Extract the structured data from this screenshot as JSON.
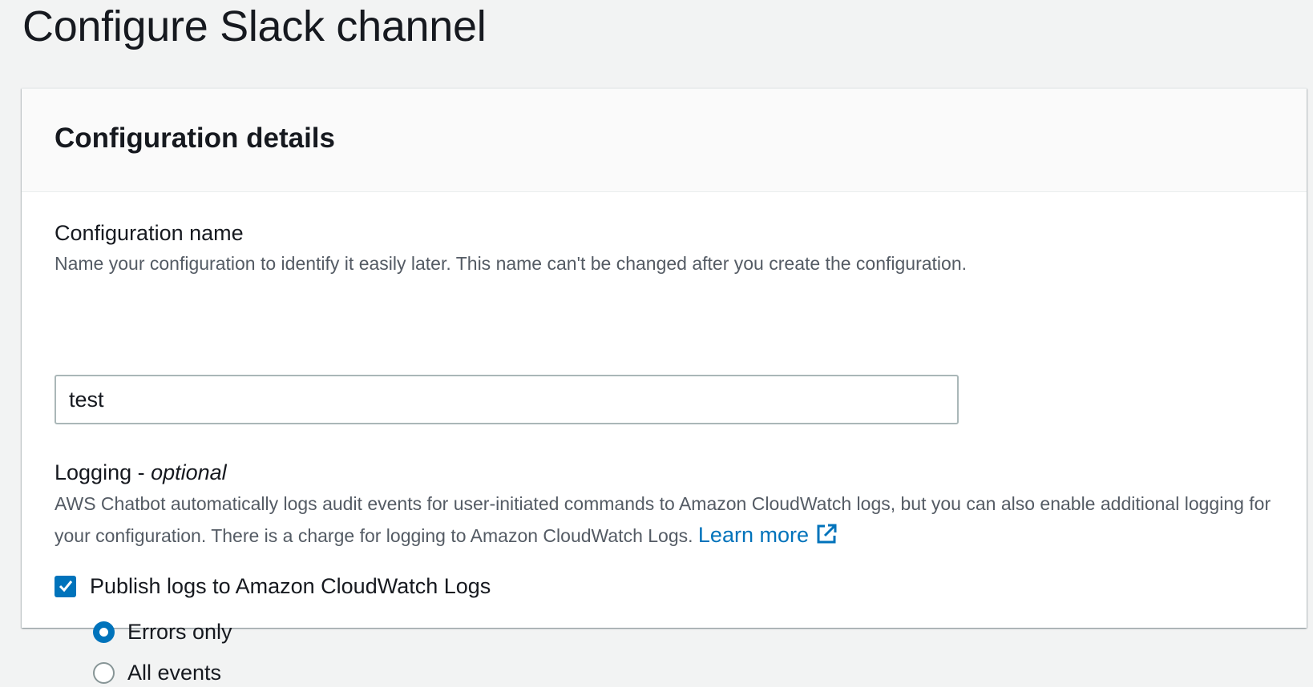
{
  "page": {
    "title": "Configure Slack channel"
  },
  "panel": {
    "title": "Configuration details"
  },
  "config_name": {
    "label": "Configuration name",
    "description": "Name your configuration to identify it easily later. This name can't be changed after you create the configuration.",
    "value": "test"
  },
  "logging": {
    "label": "Logging - ",
    "label_optional": "optional",
    "description": "AWS Chatbot automatically logs audit events for user-initiated commands to Amazon CloudWatch logs, but you can also enable additional logging for your configuration. There is a charge for logging to Amazon CloudWatch Logs.",
    "learn_more": "Learn more",
    "link_icon": "external-link-icon",
    "publish_checkbox": {
      "label": "Publish logs to Amazon CloudWatch Logs",
      "checked": true
    },
    "options": [
      {
        "label": "Errors only",
        "selected": true
      },
      {
        "label": "All events",
        "selected": false
      }
    ]
  },
  "colors": {
    "accent": "#0073bb",
    "text": "#16191f",
    "secondary_text": "#545b64",
    "background": "#f2f3f3"
  }
}
